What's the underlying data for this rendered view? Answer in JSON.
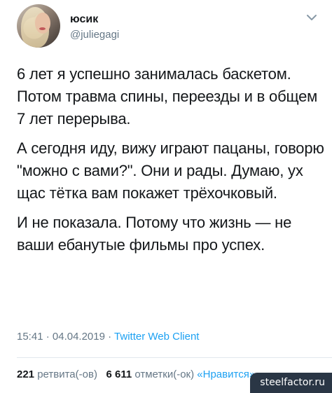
{
  "author": {
    "name": "юсик",
    "handle": "@juliegagi"
  },
  "tweet": {
    "paragraphs": [
      "6 лет я успешно занималась баскетом. Потом травма спины, переезды и в общем 7 лет перерыва.",
      "А сегодня иду, вижу играют пацаны, говорю \"можно с вами?\". Они и рады. Думаю, ух щас тётка вам покажет трёхочковый.",
      "И не показала. Потому что жизнь — не ваши ебанутые фильмы про успех."
    ]
  },
  "meta": {
    "time": "15:41",
    "date": "04.04.2019",
    "separator": "·",
    "client": "Twitter Web Client"
  },
  "stats": {
    "retweets_count": "221",
    "retweets_label": "ретвита(-ов)",
    "likes_count": "6 611",
    "likes_label": "отметки(-ок)",
    "likes_button": "«Нравится»"
  },
  "watermark": "steelfactor.ru",
  "icons": {
    "menu": "chevron-down-icon"
  },
  "colors": {
    "text": "#14171a",
    "secondary": "#657786",
    "link": "#1da1f2"
  }
}
